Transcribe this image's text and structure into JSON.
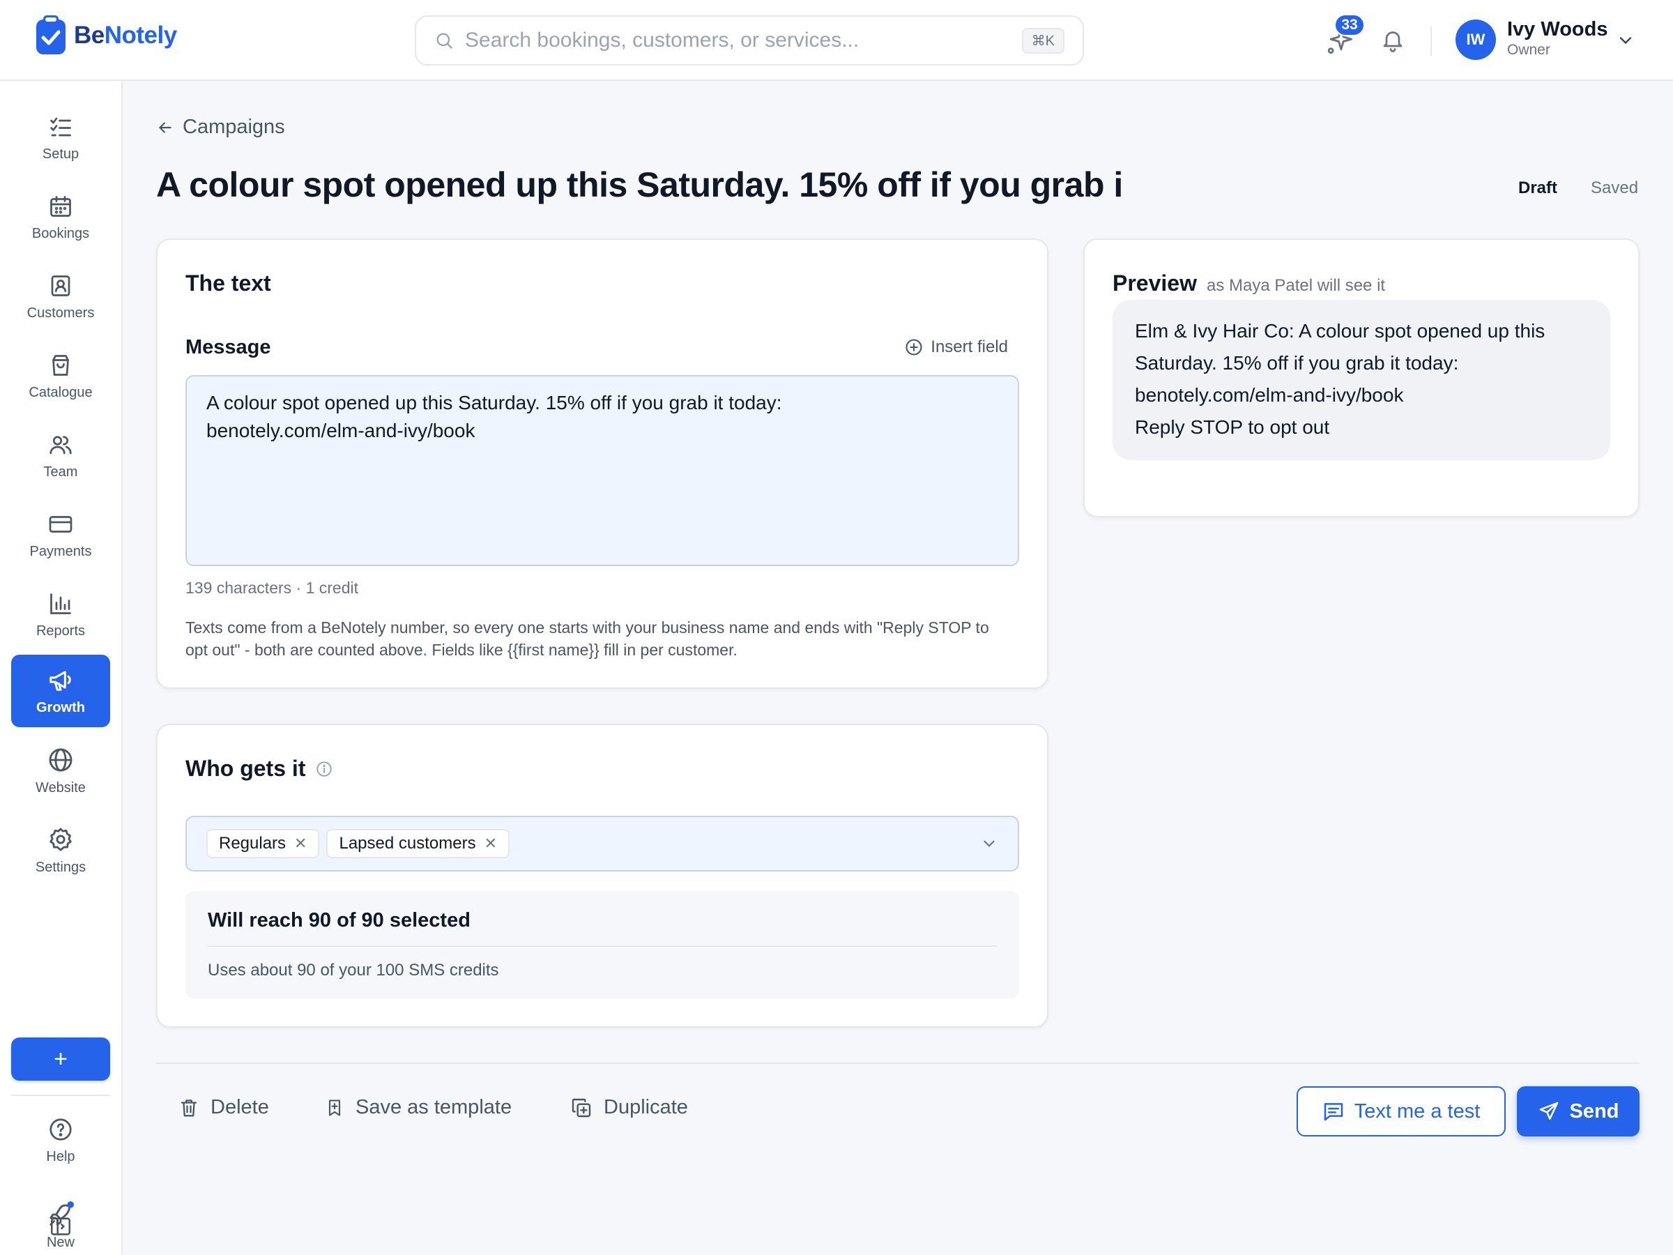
{
  "header": {
    "logo_be": "Be",
    "logo_notely": "Notely",
    "search_placeholder": "Search bookings, customers, or services...",
    "search_shortcut": "⌘K",
    "ai_badge": "33",
    "user_initials": "IW",
    "user_name": "Ivy Woods",
    "user_role": "Owner"
  },
  "sidebar": {
    "items": [
      {
        "label": "Setup",
        "icon": "checklist-icon"
      },
      {
        "label": "Bookings",
        "icon": "calendar-icon"
      },
      {
        "label": "Customers",
        "icon": "contact-card-icon"
      },
      {
        "label": "Catalogue",
        "icon": "shopping-bag-icon"
      },
      {
        "label": "Team",
        "icon": "users-icon"
      },
      {
        "label": "Payments",
        "icon": "credit-card-icon"
      },
      {
        "label": "Reports",
        "icon": "bar-chart-icon"
      },
      {
        "label": "Growth",
        "icon": "megaphone-icon",
        "active": true
      },
      {
        "label": "Website",
        "icon": "globe-icon"
      },
      {
        "label": "Settings",
        "icon": "gear-icon"
      }
    ],
    "add_label": "+",
    "help_label": "Help",
    "new_label": "New"
  },
  "page": {
    "breadcrumb": "Campaigns",
    "title": "A colour spot opened up this Saturday. 15% off if you grab i",
    "status_draft": "Draft",
    "status_saved": "Saved"
  },
  "text_card": {
    "title": "The text",
    "message_label": "Message",
    "insert_field": "Insert field",
    "message_line1": "A colour spot opened up this Saturday. 15% off if you grab it today:",
    "message_line2": "benotely.com/elm-and-ivy/book",
    "char_count": "139 characters · 1 credit",
    "help": "Texts come from a BeNotely number, so every one starts with your business name and ends with \"Reply STOP to opt out\" - both are counted above. Fields like {{first name}} fill in per customer."
  },
  "audience_card": {
    "title": "Who gets it",
    "chips": [
      "Regulars",
      "Lapsed customers"
    ],
    "reach_title": "Will reach 90 of 90 selected",
    "reach_sub": "Uses about 90 of your 100 SMS credits"
  },
  "preview_card": {
    "title": "Preview",
    "subtitle": "as Maya Patel will see it",
    "line1": "Elm & Ivy Hair Co: A colour spot opened up this",
    "line2": "Saturday. 15% off if you grab it today:",
    "line3": "benotely.com/elm-and-ivy/book",
    "line4": "Reply STOP to opt out"
  },
  "actions": {
    "delete": "Delete",
    "save_template": "Save as template",
    "duplicate": "Duplicate",
    "text_test": "Text me a test",
    "send": "Send"
  },
  "colors": {
    "accent": "#2563eb",
    "background": "#f5f7fa",
    "input_fill": "#eff5ff"
  }
}
